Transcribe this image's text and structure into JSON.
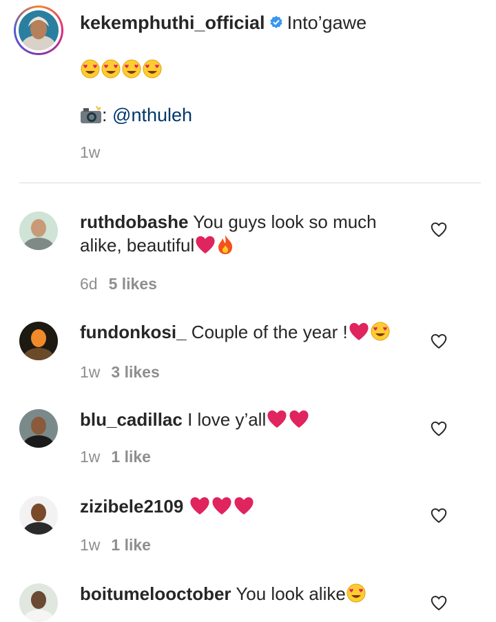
{
  "caption": {
    "username": "kekemphuthi_official",
    "text": "Into’gawe",
    "emoji_line": [
      "heart-eyes-emoji",
      "heart-eyes-emoji",
      "heart-eyes-emoji",
      "heart-eyes-emoji"
    ],
    "camera_icon": "camera-flash-icon",
    "credit_sep": ":",
    "mention": "@nthuleh",
    "time": "1w"
  },
  "comments": [
    {
      "username": "ruthdobashe",
      "text": "You guys look so much alike, beautiful",
      "emojis": [
        "red-heart-emoji",
        "fire-emoji"
      ],
      "time": "6d",
      "likes": "5 likes"
    },
    {
      "username": "fundonkosi_",
      "text": "Couple of the year !",
      "emojis": [
        "red-heart-emoji",
        "heart-eyes-emoji"
      ],
      "time": "1w",
      "likes": "3 likes"
    },
    {
      "username": "blu_cadillac",
      "text": "I love y’all",
      "emojis": [
        "red-heart-emoji",
        "red-heart-emoji"
      ],
      "time": "1w",
      "likes": "1 like"
    },
    {
      "username": "zizibele2109",
      "text": "",
      "emojis": [
        "red-heart-emoji",
        "red-heart-emoji",
        "red-heart-emoji"
      ],
      "time": "1w",
      "likes": "1 like"
    },
    {
      "username": "boitumelooctober",
      "text": "You look alike",
      "emojis": [
        "heart-eyes-emoji"
      ],
      "time": "",
      "likes": ""
    }
  ],
  "colors": {
    "text": "#262626",
    "muted": "#8e8e8e",
    "link": "#00376b",
    "verified": "#3897f0",
    "heart": "#e0245e"
  }
}
